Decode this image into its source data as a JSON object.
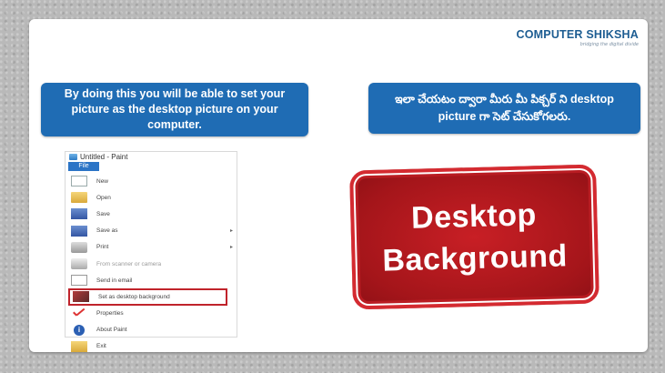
{
  "logo": {
    "name": "COMPUTER SHIKSHA",
    "tagline": "bridging the digital divide"
  },
  "callouts": {
    "english": "By doing this you will be able to set your picture as the desktop picture on your computer.",
    "telugu": "ఇలా చేయటం ద్వారా మీరు మీ పిక్చర్ ని desktop picture గా సెట్ చేసుకోగలరు."
  },
  "paint_menu": {
    "window_title": "Untitled - Paint",
    "file_tab": "File",
    "items": [
      {
        "label": "New",
        "icon": "new-file-icon",
        "arrow": ""
      },
      {
        "label": "Open",
        "icon": "open-folder-icon",
        "arrow": ""
      },
      {
        "label": "Save",
        "icon": "save-icon",
        "arrow": ""
      },
      {
        "label": "Save as",
        "icon": "save-as-icon",
        "arrow": "▸"
      },
      {
        "label": "Print",
        "icon": "printer-icon",
        "arrow": "▸"
      },
      {
        "label": "From scanner or camera",
        "icon": "scanner-icon",
        "arrow": ""
      },
      {
        "label": "Send in email",
        "icon": "email-icon",
        "arrow": ""
      },
      {
        "label": "Set as desktop background",
        "icon": "desktop-background-icon",
        "arrow": "▸"
      },
      {
        "label": "Properties",
        "icon": "checkmark-icon",
        "arrow": ""
      },
      {
        "label": "About Paint",
        "icon": "info-icon",
        "arrow": ""
      },
      {
        "label": "Exit",
        "icon": "exit-icon",
        "arrow": ""
      }
    ],
    "highlighted_index": 7
  },
  "stamp": {
    "line1": "Desktop",
    "line2": "Background"
  },
  "colors": {
    "callout": "#1f6cb4",
    "stamp": "#c81f25",
    "highlight": "#c0232b"
  }
}
